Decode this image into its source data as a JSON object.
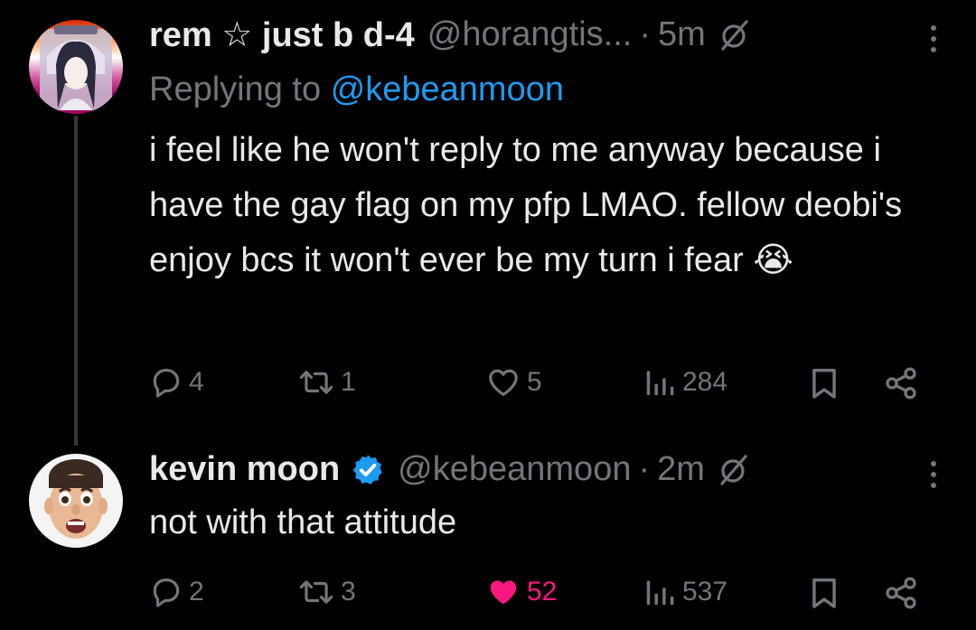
{
  "tweets": [
    {
      "display_name": "rem ☆ just b d-4",
      "handle": "@horangtis...",
      "dot": "·",
      "time": "5m",
      "replying_prefix": "Replying to",
      "replying_to": "@kebeanmoon",
      "text": "i feel like he won't reply to me anyway because i have the gay flag on my pfp LMAO. fellow deobi's enjoy bcs it won't ever be my turn i fear",
      "emoji": "😭",
      "replies": "4",
      "reposts": "1",
      "likes": "5",
      "views": "284",
      "liked": false
    },
    {
      "display_name": "kevin moon",
      "verified": true,
      "handle": "@kebeanmoon",
      "dot": "·",
      "time": "2m",
      "text": "not with that attitude",
      "replies": "2",
      "reposts": "3",
      "likes": "52",
      "views": "537",
      "liked": true
    }
  ],
  "colors": {
    "background": "#000000",
    "text": "#e7e9ea",
    "muted": "#71767b",
    "link": "#1d9bf0",
    "like": "#f91880",
    "verified": "#1d9bf0"
  },
  "icons": [
    "reply-icon",
    "repost-icon",
    "like-icon",
    "views-icon",
    "bookmark-icon",
    "share-icon",
    "grok-icon",
    "more-icon",
    "verified-badge-icon"
  ]
}
